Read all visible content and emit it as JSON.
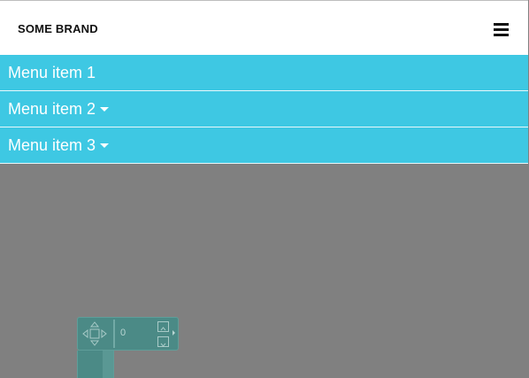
{
  "navbar": {
    "brand": "SOME BRAND",
    "menu_icon": "hamburger-icon"
  },
  "menu": {
    "items": [
      {
        "label": "Menu item 1",
        "has_dropdown": false
      },
      {
        "label": "Menu item 2",
        "has_dropdown": true
      },
      {
        "label": "Menu item 3",
        "has_dropdown": true
      }
    ]
  },
  "widget": {
    "value": "0",
    "icons": [
      "dpad-move-icon",
      "page-up-icon",
      "page-down-icon",
      "expand-arrow-icon"
    ]
  },
  "colors": {
    "menu_background": "#3ec8e3",
    "page_background": "#808080",
    "widget_background": "#4b8a86"
  }
}
